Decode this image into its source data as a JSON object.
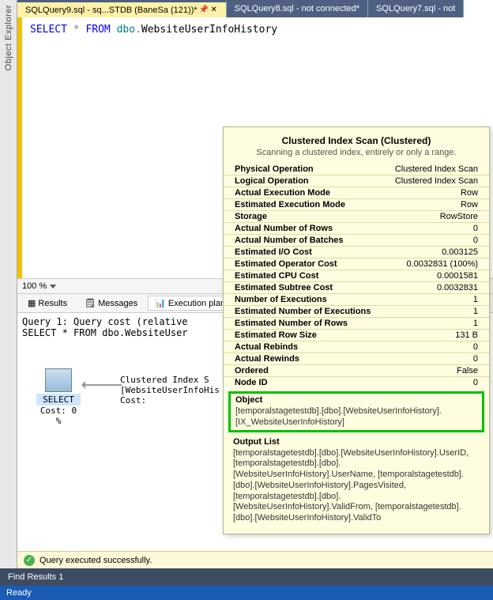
{
  "sidebar": {
    "label": "Object Explorer"
  },
  "tabs": [
    {
      "label": "SQLQuery9.sql - sq...STDB (BaneSa (121))*",
      "active": true
    },
    {
      "label": "SQLQuery8.sql - not connected*",
      "active": false
    },
    {
      "label": "SQLQuery7.sql - not",
      "active": false
    }
  ],
  "editor": {
    "line": "SELECT * FROM dbo.WebsiteUserInfoHistory"
  },
  "zoom": {
    "value": "100 %"
  },
  "result_tabs": {
    "results": "Results",
    "messages": "Messages",
    "execution_plan": "Execution plan"
  },
  "plan": {
    "line1": "Query 1: Query cost (relative",
    "line2": "SELECT * FROM dbo.WebsiteUser",
    "select_label": "SELECT",
    "select_cost": "Cost: 0 %",
    "scan_title": "Clustered Index S",
    "scan_obj": "[WebsiteUserInfoHis",
    "scan_cost": "Cost:"
  },
  "tooltip": {
    "title": "Clustered Index Scan (Clustered)",
    "desc": "Scanning a clustered index, entirely or only a range.",
    "rows": [
      {
        "k": "Physical Operation",
        "v": "Clustered Index Scan"
      },
      {
        "k": "Logical Operation",
        "v": "Clustered Index Scan"
      },
      {
        "k": "Actual Execution Mode",
        "v": "Row"
      },
      {
        "k": "Estimated Execution Mode",
        "v": "Row"
      },
      {
        "k": "Storage",
        "v": "RowStore"
      },
      {
        "k": "Actual Number of Rows",
        "v": "0"
      },
      {
        "k": "Actual Number of Batches",
        "v": "0"
      },
      {
        "k": "Estimated I/O Cost",
        "v": "0.003125"
      },
      {
        "k": "Estimated Operator Cost",
        "v": "0.0032831 (100%)"
      },
      {
        "k": "Estimated CPU Cost",
        "v": "0.0001581"
      },
      {
        "k": "Estimated Subtree Cost",
        "v": "0.0032831"
      },
      {
        "k": "Number of Executions",
        "v": "1"
      },
      {
        "k": "Estimated Number of Executions",
        "v": "1"
      },
      {
        "k": "Estimated Number of Rows",
        "v": "1"
      },
      {
        "k": "Estimated Row Size",
        "v": "131 B"
      },
      {
        "k": "Actual Rebinds",
        "v": "0"
      },
      {
        "k": "Actual Rewinds",
        "v": "0"
      },
      {
        "k": "Ordered",
        "v": "False"
      },
      {
        "k": "Node ID",
        "v": "0"
      }
    ],
    "object_title": "Object",
    "object_body": "[temporalstagetestdb].[dbo].[WebsiteUserInfoHistory].[IX_WebsiteUserInfoHistory]",
    "output_title": "Output List",
    "output_body": "[temporalstagetestdb].[dbo].[WebsiteUserInfoHistory].UserID, [temporalstagetestdb].[dbo].[WebsiteUserInfoHistory].UserName, [temporalstagetestdb].[dbo].[WebsiteUserInfoHistory].PagesVisited, [temporalstagetestdb].[dbo].[WebsiteUserInfoHistory].ValidFrom, [temporalstagetestdb].[dbo].[WebsiteUserInfoHistory].ValidTo"
  },
  "status": {
    "text": "Query executed successfully."
  },
  "find_results": {
    "label": "Find Results 1"
  },
  "ready": {
    "label": "Ready"
  }
}
